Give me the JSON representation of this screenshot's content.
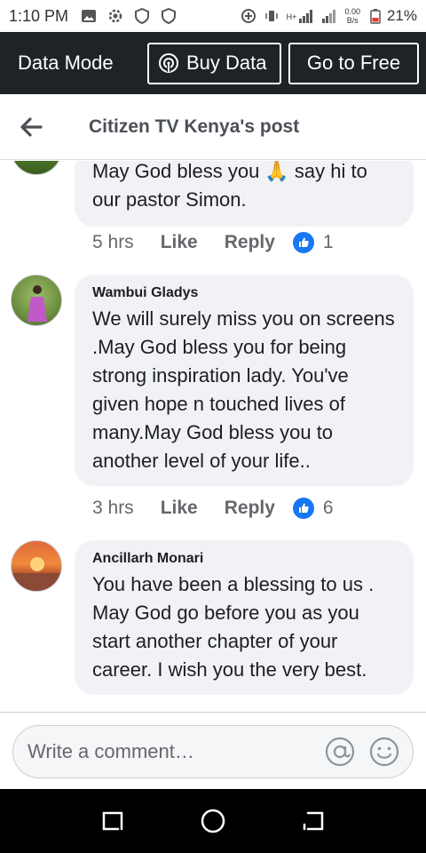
{
  "status_bar": {
    "time": "1:10 PM",
    "net_speed_value": "0.00",
    "net_speed_unit": "B/s",
    "net_type": "H+",
    "battery_percent": "21%"
  },
  "data_bar": {
    "mode_label": "Data Mode",
    "buy_label": "Buy Data",
    "free_label": "Go to Free"
  },
  "header": {
    "title": "Citizen TV Kenya's post"
  },
  "comments": [
    {
      "author": "",
      "text": "May God bless you 🙏 say hi to our pastor Simon.",
      "time": "5 hrs",
      "like_label": "Like",
      "reply_label": "Reply",
      "reaction_count": "1"
    },
    {
      "author": "Wambui Gladys",
      "text": "We will surely miss you on screens .May God bless you for being strong inspiration lady. You've given hope n touched lives of many.May God bless you to another level of your life..",
      "time": "3 hrs",
      "like_label": "Like",
      "reply_label": "Reply",
      "reaction_count": "6"
    },
    {
      "author": "Ancillarh Monari",
      "text": "You have been a blessing to us . May God go before you as you start another chapter of your career.  I wish you the very best.",
      "time": "",
      "like_label": "",
      "reply_label": "",
      "reaction_count": ""
    }
  ],
  "composer": {
    "placeholder": "Write a comment…"
  },
  "colors": {
    "data_bar_bg": "#1f2328",
    "bubble_bg": "#f0f2f5",
    "like_badge": "#1877f2",
    "nav_bar_bg": "#000000"
  },
  "icons": {
    "back": "back-arrow-icon",
    "buy": "broadcast-icon",
    "mention": "at-sign-icon",
    "emoji": "smiley-icon",
    "nav_recent": "recents-icon",
    "nav_home": "home-icon",
    "nav_back": "nav-back-icon"
  }
}
